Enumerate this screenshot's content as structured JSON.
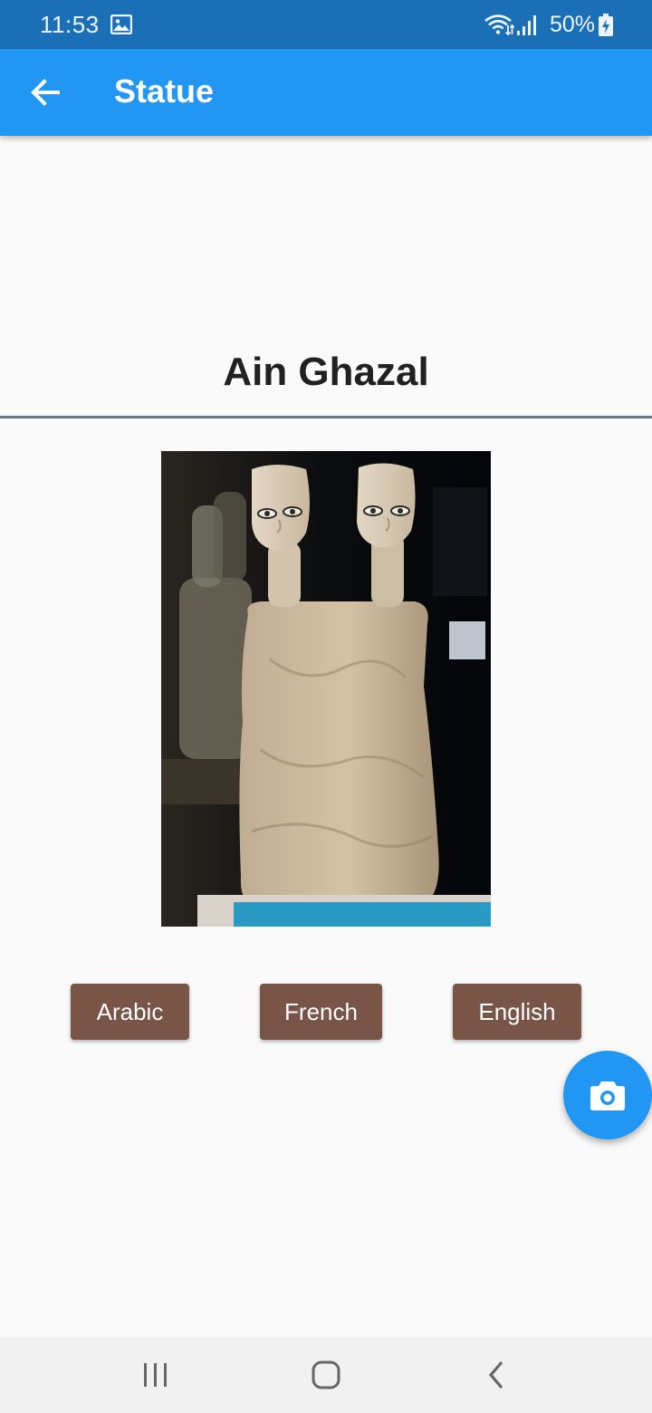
{
  "status_bar": {
    "time": "11:53",
    "battery": "50%",
    "icons": [
      "gallery-icon",
      "wifi-icon",
      "signal-icon",
      "battery-charging-icon"
    ]
  },
  "app_bar": {
    "title": "Statue",
    "back_icon": "arrow-back-icon",
    "color": "#2196f3"
  },
  "content": {
    "statue_name": "Ain Ghazal",
    "image": "ain-ghazal-statue-photo"
  },
  "language_buttons": [
    {
      "label": "Arabic"
    },
    {
      "label": "French"
    },
    {
      "label": "English"
    }
  ],
  "fab": {
    "icon": "camera-icon"
  },
  "nav_bar": {
    "icons": [
      "recent-apps-icon",
      "home-icon",
      "back-icon"
    ]
  },
  "colors": {
    "status_bar": "#1a6fb7",
    "app_bar": "#2196f3",
    "language_button": "#795548",
    "background": "#fafafa"
  }
}
